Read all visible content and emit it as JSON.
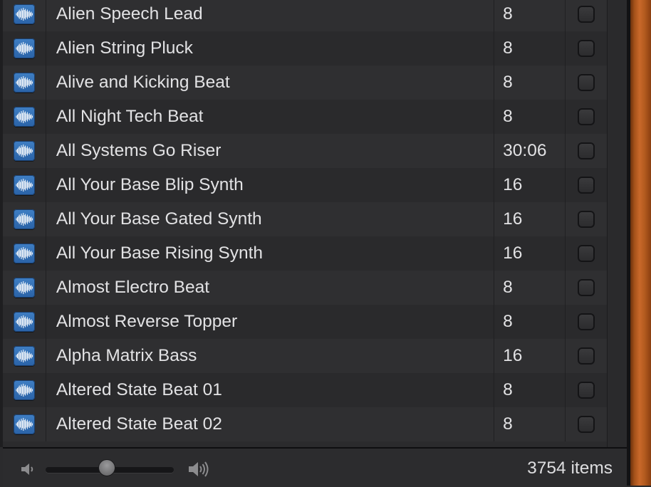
{
  "loops": [
    {
      "name": "Alien Speech Lead",
      "beats": "8"
    },
    {
      "name": "Alien String Pluck",
      "beats": "8"
    },
    {
      "name": "Alive and Kicking Beat",
      "beats": "8"
    },
    {
      "name": "All Night Tech Beat",
      "beats": "8"
    },
    {
      "name": "All Systems Go Riser",
      "beats": "30:06"
    },
    {
      "name": "All Your Base Blip Synth",
      "beats": "16"
    },
    {
      "name": "All Your Base Gated Synth",
      "beats": "16"
    },
    {
      "name": "All Your Base Rising Synth",
      "beats": "16"
    },
    {
      "name": "Almost Electro Beat",
      "beats": "8"
    },
    {
      "name": "Almost Reverse Topper",
      "beats": "8"
    },
    {
      "name": "Alpha Matrix Bass",
      "beats": "16"
    },
    {
      "name": "Altered State Beat 01",
      "beats": "8"
    },
    {
      "name": "Altered State Beat 02",
      "beats": "8"
    }
  ],
  "row_icon": "audio-waveform-icon",
  "footer": {
    "item_count": "3754 items",
    "volume_low_icon": "speaker-low-icon",
    "volume_high_icon": "speaker-high-icon",
    "volume_level": 0.48
  },
  "colors": {
    "icon_blue": "#3f7fc4",
    "wood_accent": "#b25a1e"
  }
}
